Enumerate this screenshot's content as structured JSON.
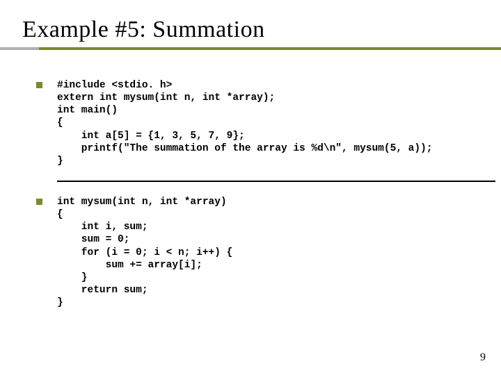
{
  "title": "Example #5: Summation",
  "code_block_1": "#include <stdio. h>\nextern int mysum(int n, int *array);\nint main()\n{\n    int a[5] = {1, 3, 5, 7, 9};\n    printf(\"The summation of the array is %d\\n\", mysum(5, a));\n}",
  "code_block_2": "int mysum(int n, int *array)\n{\n    int i, sum;\n    sum = 0;\n    for (i = 0; i < n; i++) {\n        sum += array[i];\n    }\n    return sum;\n}",
  "page_number": "9"
}
